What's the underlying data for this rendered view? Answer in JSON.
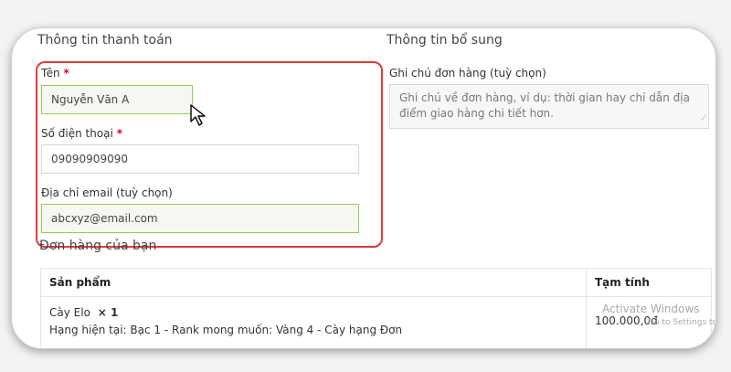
{
  "billing": {
    "title": "Thông tin thanh toán",
    "name_label": "Tên",
    "name_value": "Nguyễn Văn A",
    "phone_label": "Số điện thoại",
    "phone_value": "09090909090",
    "email_label": "Địa chỉ email (tuỳ chọn)",
    "email_value": "abcxyz@email.com",
    "required_mark": "*"
  },
  "additional": {
    "title": "Thông tin bổ sung",
    "notes_label": "Ghi chú đơn hàng (tuỳ chọn)",
    "notes_placeholder": "Ghi chú về đơn hàng, ví dụ: thời gian hay chỉ dẫn địa điểm giao hàng chi tiết hơn."
  },
  "order": {
    "title": "Đơn hàng của bạn",
    "col_product": "Sản phẩm",
    "col_subtotal": "Tạm tính",
    "item_name": "Cày Elo",
    "item_qty": "× 1",
    "item_detail": "Hạng hiện tại: Bạc 1 - Rank mong muốn: Vàng 4 - Cày hạng Đơn",
    "item_price": "100.000,0đ"
  },
  "watermark": {
    "line1": "Activate Windows",
    "line2": "Go to Settings to activate"
  },
  "colors": {
    "highlight": "#e33a3a",
    "valid_border": "#8fcf4f",
    "required": "#e2001a"
  }
}
